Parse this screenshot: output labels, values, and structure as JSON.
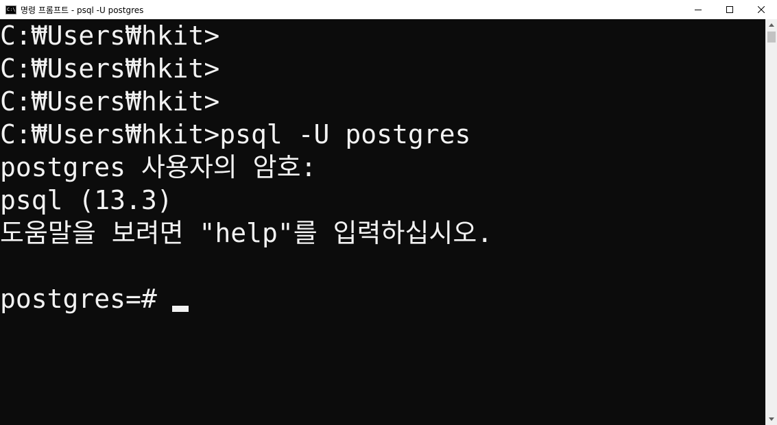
{
  "window": {
    "title": "명령 프롬프트 - psql  -U postgres",
    "icon": "cmd-icon",
    "icon_label": "C:\\"
  },
  "controls": {
    "minimize_icon": "minimize-icon",
    "maximize_icon": "maximize-icon",
    "close_icon": "close-icon"
  },
  "console": {
    "lines": [
      "C:₩Users₩hkit>",
      "C:₩Users₩hkit>",
      "C:₩Users₩hkit>",
      "C:₩Users₩hkit>psql -U postgres",
      "postgres 사용자의 암호:",
      "psql (13.3)",
      "도움말을 보려면 \"help\"를 입력하십시오.",
      "",
      "postgres=#"
    ]
  },
  "colors": {
    "console_bg": "#0c0c0c",
    "console_fg": "#f2f2f2",
    "titlebar_bg": "#ffffff"
  }
}
